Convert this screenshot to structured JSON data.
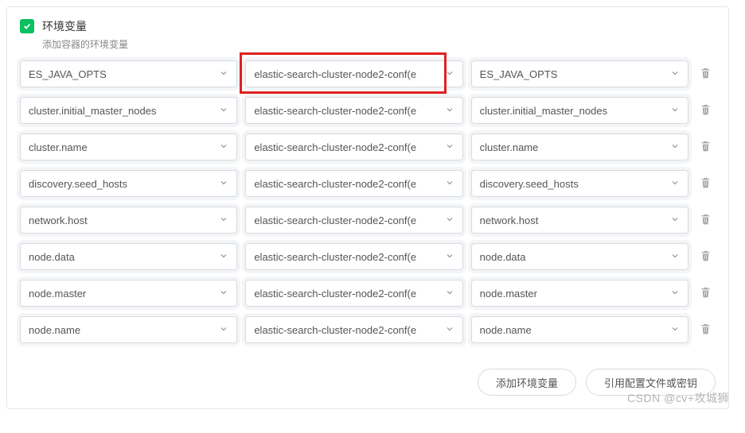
{
  "header": {
    "title": "环境变量",
    "subtitle": "添加容器的环境变量"
  },
  "rows": [
    {
      "key": "ES_JAVA_OPTS",
      "source": "elastic-search-cluster-node2-conf(e",
      "value": "ES_JAVA_OPTS",
      "highlight": true
    },
    {
      "key": "cluster.initial_master_nodes",
      "source": "elastic-search-cluster-node2-conf(e",
      "value": "cluster.initial_master_nodes"
    },
    {
      "key": "cluster.name",
      "source": "elastic-search-cluster-node2-conf(e",
      "value": "cluster.name"
    },
    {
      "key": "discovery.seed_hosts",
      "source": "elastic-search-cluster-node2-conf(e",
      "value": "discovery.seed_hosts"
    },
    {
      "key": "network.host",
      "source": "elastic-search-cluster-node2-conf(e",
      "value": "network.host"
    },
    {
      "key": "node.data",
      "source": "elastic-search-cluster-node2-conf(e",
      "value": "node.data"
    },
    {
      "key": "node.master",
      "source": "elastic-search-cluster-node2-conf(e",
      "value": "node.master"
    },
    {
      "key": "node.name",
      "source": "elastic-search-cluster-node2-conf(e",
      "value": "node.name"
    }
  ],
  "footer": {
    "add": "添加环境变量",
    "import": "引用配置文件或密钥"
  },
  "watermark": "CSDN @cv+攻城狮"
}
